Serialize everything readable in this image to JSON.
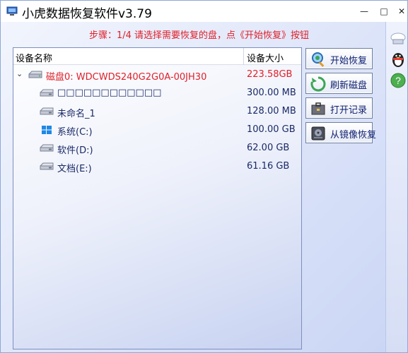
{
  "window": {
    "title": "小虎数据恢复软件v3.79",
    "controls": {
      "minimize": "—",
      "maximize": "□",
      "close": "✕"
    }
  },
  "step_instruction": "步骤：1/4 请选择需要恢复的盘，点《开始恢复》按钮",
  "list": {
    "columns": {
      "name": "设备名称",
      "size": "设备大小"
    },
    "disk": {
      "caret": "⌄",
      "name": "磁盘0: WDCWDS240G2G0A-00JH30",
      "size": "223.58GB",
      "icon": "hard-drive-icon"
    },
    "partitions": [
      {
        "name": "□□□□□□□□□□□□",
        "size": "300.00 MB",
        "icon": "drive-icon"
      },
      {
        "name": "未命名_1",
        "size": "128.00 MB",
        "icon": "drive-icon"
      },
      {
        "name": "系统(C:)",
        "size": "100.00 GB",
        "icon": "windows-icon"
      },
      {
        "name": "软件(D:)",
        "size": "62.00 GB",
        "icon": "drive-icon"
      },
      {
        "name": "文档(E:)",
        "size": "61.16 GB",
        "icon": "drive-icon"
      }
    ]
  },
  "actions": {
    "start": "开始恢复",
    "refresh": "刷新磁盘",
    "open_record": "打开记录",
    "image_recover": "从镜像恢复"
  },
  "side_icons": [
    "cloud-drive-icon",
    "penguin-icon",
    "help-icon"
  ],
  "colors": {
    "accent_red": "#e0202a",
    "text_blue": "#0b1d6e"
  }
}
